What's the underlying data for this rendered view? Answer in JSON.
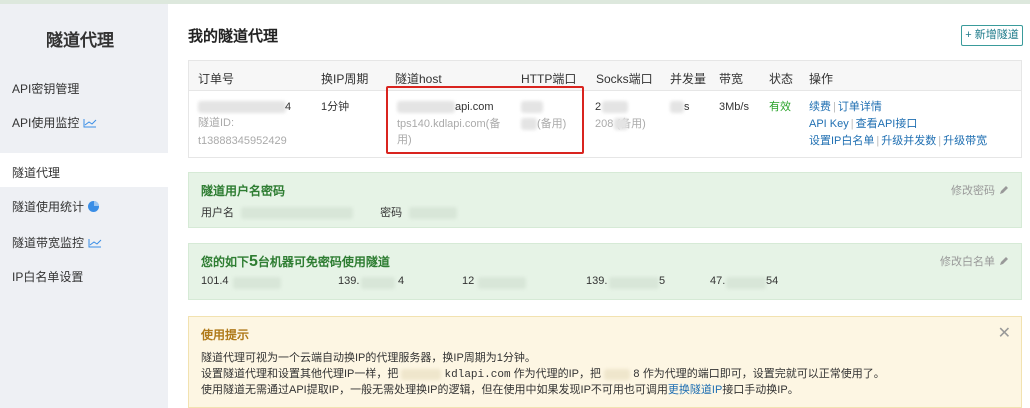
{
  "sidebar": {
    "title": "隧道代理",
    "items": [
      {
        "label": "API密钥管理"
      },
      {
        "label": "API使用监控"
      },
      {
        "label": "隧道代理"
      },
      {
        "label": "隧道使用统计"
      },
      {
        "label": "隧道带宽监控"
      },
      {
        "label": "IP白名单设置"
      }
    ]
  },
  "main": {
    "title": "我的隧道代理",
    "add_button": "+ 新增隧道"
  },
  "table": {
    "columns": [
      "订单号",
      "换IP周期",
      "隧道host",
      "HTTP端口",
      "Socks端口",
      "并发量",
      "带宽",
      "状态",
      "操作"
    ],
    "row": {
      "order_id_suffix": "4",
      "tunnel_id_label": "隧道ID:",
      "order_sub": "t13888345952429",
      "cycle": "1分钟",
      "host_main": "api.com",
      "host_backup": "tps140.kdlapi.com(备用)",
      "http_port_backup": "(备用)",
      "socks_port": "2",
      "socks_port_backup": "208 (备用)",
      "concurrency": "s",
      "bandwidth": "3Mb/s",
      "status": "有效",
      "actions": {
        "renew": "续费",
        "order_detail": "订单详情",
        "api_key": "API Key",
        "view_api": "查看API接口",
        "set_whitelist": "设置IP白名单",
        "upgrade_concurrency": "升级并发数",
        "upgrade_bandwidth": "升级带宽"
      }
    }
  },
  "auth_panel": {
    "title": "隧道用户名密码",
    "action": "修改密码",
    "username_label": "用户名",
    "password_label": "密码"
  },
  "whitelist_panel": {
    "title_prefix": "您的如下",
    "count": "5",
    "title_suffix": "台机器可免密码使用隧道",
    "action": "修改白名单",
    "ips": [
      "101.4",
      "139.",
      "12",
      "139.",
      "47."
    ],
    "ip_tails": [
      "",
      "4",
      "",
      "5",
      "54"
    ]
  },
  "tips": {
    "title": "使用提示",
    "line1": "隧道代理可视为一个云端自动换IP的代理服务器，换IP周期为1分钟。",
    "line2_a": "设置隧道代理和设置其他代理IP一样，把",
    "line2_host": "kdlapi.com",
    "line2_b": "作为代理的IP，把",
    "line2_port": "8",
    "line2_c": "作为代理的端口即可，设置完就可以正常使用了。",
    "line3_a": "使用隧道无需通过API提取IP，一般无需处理换IP的逻辑，但在使用中如果发现IP不可用也可调用",
    "line3_link": "更换隧道IP",
    "line3_b": "接口手动换IP。"
  }
}
